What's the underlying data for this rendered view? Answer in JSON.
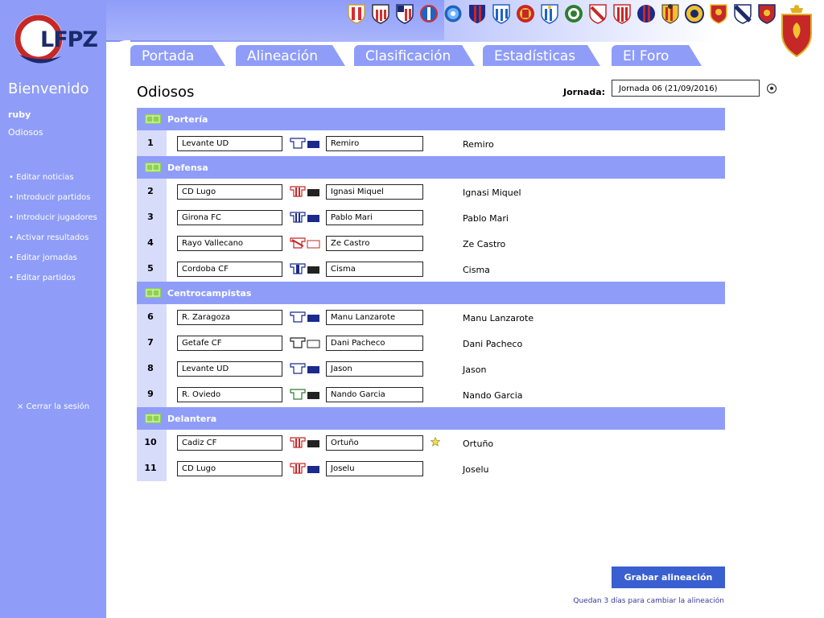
{
  "site": {
    "logo_text": "LFPZ"
  },
  "sidebar": {
    "welcome": "Bienvenido",
    "username": "ruby",
    "team": "Odiosos",
    "admin_links": [
      "• Editar noticias",
      "• Introducir partidos",
      "• Introducir jugadores",
      "• Activar resultados",
      "• Editar jornadas",
      "• Editar partidos"
    ],
    "logout": "× Cerrar la sesión"
  },
  "nav": {
    "tabs": [
      "Portada",
      "Alineación",
      "Clasificación",
      "Estadísticas",
      "El Foro"
    ]
  },
  "page": {
    "title": "Odiosos",
    "jornada_label": "Jornada:",
    "jornada_value": "Jornada 06 (21/09/2016)"
  },
  "lineup": {
    "sections": [
      {
        "label": "Portería",
        "players": [
          {
            "num": "1",
            "team": "Levante UD",
            "player": "Remiro",
            "name": "Remiro"
          }
        ]
      },
      {
        "label": "Defensa",
        "players": [
          {
            "num": "2",
            "team": "CD Lugo",
            "player": "Ignasi Miquel",
            "name": "Ignasi Miquel"
          },
          {
            "num": "3",
            "team": "Girona FC",
            "player": "Pablo Mari",
            "name": "Pablo Mari"
          },
          {
            "num": "4",
            "team": "Rayo Vallecano",
            "player": "Ze Castro",
            "name": "Ze Castro"
          },
          {
            "num": "5",
            "team": "Cordoba CF",
            "player": "Cisma",
            "name": "Cisma"
          }
        ]
      },
      {
        "label": "Centrocampistas",
        "players": [
          {
            "num": "6",
            "team": "R. Zaragoza",
            "player": "Manu Lanzarote",
            "name": "Manu Lanzarote"
          },
          {
            "num": "7",
            "team": "Getafe CF",
            "player": "Dani Pacheco",
            "name": "Dani Pacheco"
          },
          {
            "num": "8",
            "team": "Levante UD",
            "player": "Jason",
            "name": "Jason"
          },
          {
            "num": "9",
            "team": "R. Oviedo",
            "player": "Nando Garcia",
            "name": "Nando Garcia"
          }
        ]
      },
      {
        "label": "Delantera",
        "players": [
          {
            "num": "10",
            "team": "Cadiz CF",
            "player": "Ortuño",
            "name": "Ortuño"
          },
          {
            "num": "11",
            "team": "CD Lugo",
            "player": "Joselu",
            "name": "Joselu"
          }
        ]
      }
    ]
  },
  "footer": {
    "save_label": "Grabar alineación",
    "deadline": "Quedan 3 días para cambiar la alineación"
  },
  "colors": {
    "sidebar": "#8f9df9",
    "section_header": "#8f9df9",
    "number_cell": "#d7dcfb",
    "save_button": "#3a5fd0"
  }
}
